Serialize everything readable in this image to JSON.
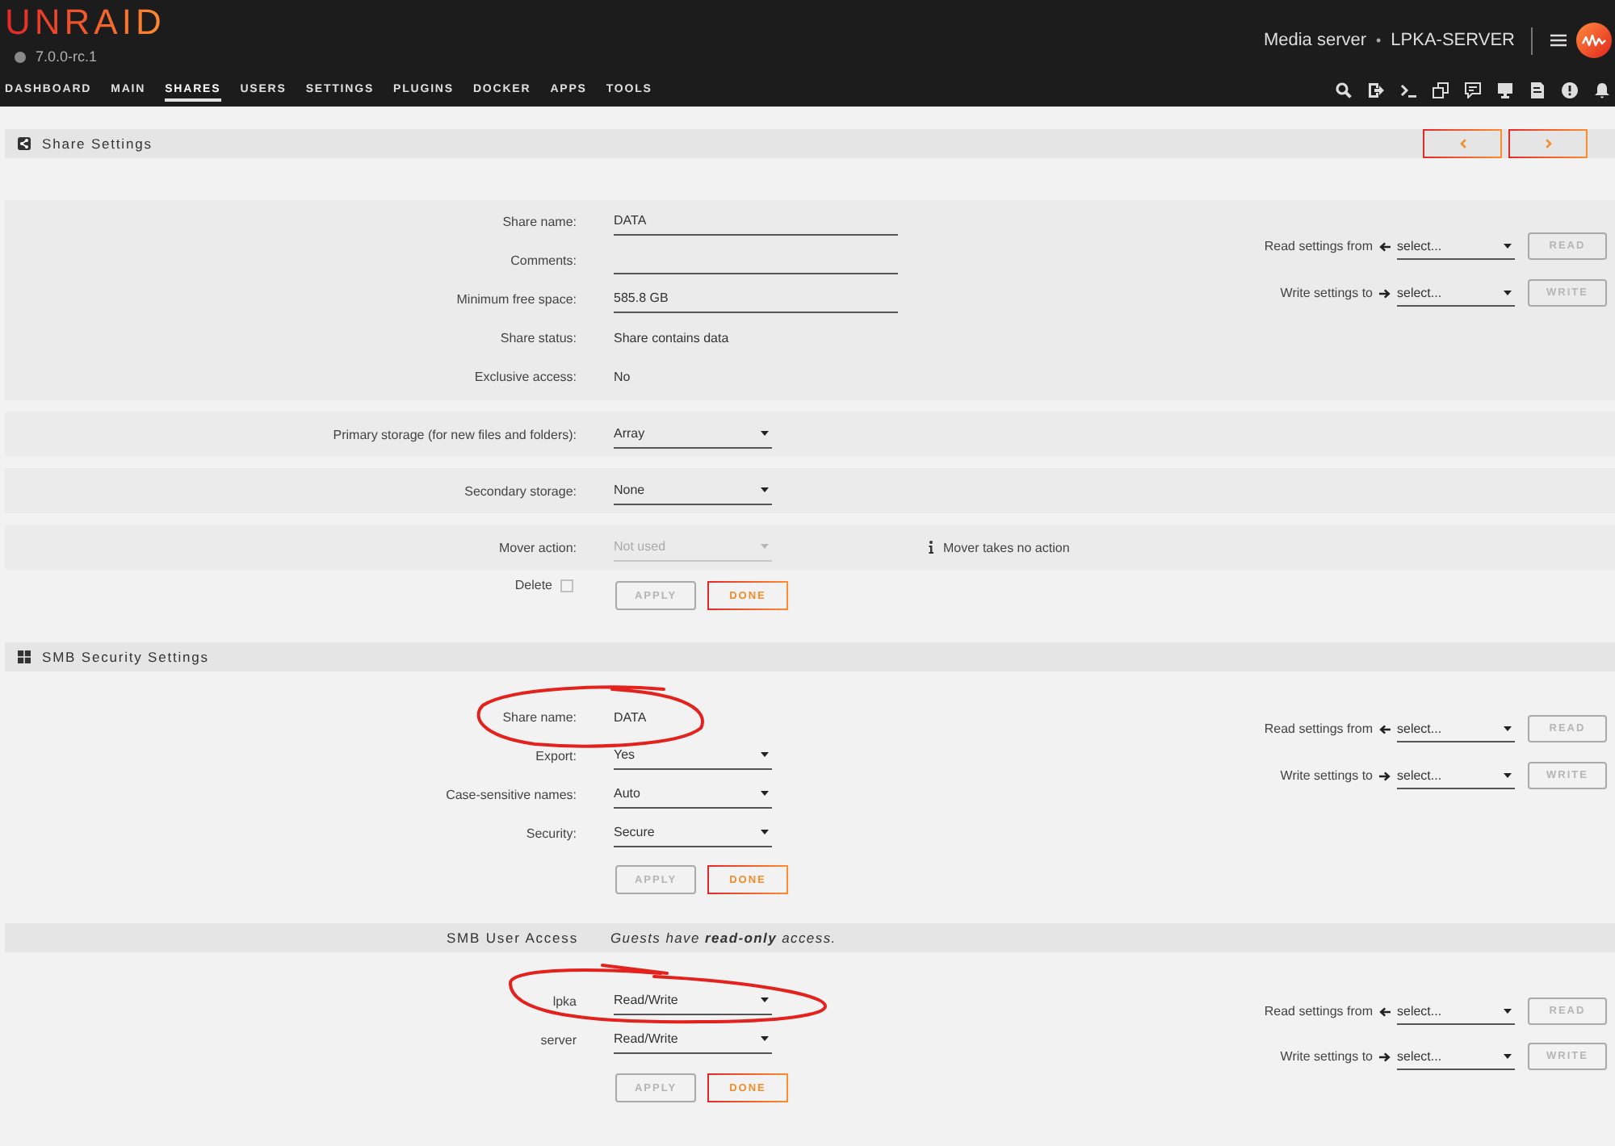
{
  "header": {
    "logo": "UNRAID",
    "version": "7.0.0-rc.1",
    "server_description": "Media server",
    "separator": "•",
    "server_name": "LPKA-SERVER"
  },
  "nav": [
    {
      "label": "DASHBOARD",
      "selected": false
    },
    {
      "label": "MAIN",
      "selected": false
    },
    {
      "label": "SHARES",
      "selected": true
    },
    {
      "label": "USERS",
      "selected": false
    },
    {
      "label": "SETTINGS",
      "selected": false
    },
    {
      "label": "PLUGINS",
      "selected": false
    },
    {
      "label": "DOCKER",
      "selected": false
    },
    {
      "label": "APPS",
      "selected": false
    },
    {
      "label": "TOOLS",
      "selected": false
    }
  ],
  "share_settings": {
    "title": "Share Settings",
    "groups": [
      {
        "fields": [
          {
            "label": "Share name:",
            "kind": "input",
            "value": "DATA",
            "disabled": false
          },
          {
            "label": "Comments:",
            "kind": "input",
            "disabled": false
          },
          {
            "label": "Minimum free space:",
            "kind": "input",
            "value": "585.8 GB",
            "disabled": false
          },
          {
            "label": "Share status:",
            "kind": "text",
            "value": "Share contains data",
            "disabled": false
          },
          {
            "label": "Exclusive access:",
            "kind": "text",
            "value": "No",
            "disabled": false
          }
        ],
        "sync": [
          {
            "kind": "read",
            "label": "Read settings from",
            "value": "select...",
            "button": "READ",
            "disabled": true
          },
          {
            "kind": "write",
            "label": "Write settings to",
            "value": "select...",
            "button": "WRITE",
            "disabled": true
          }
        ]
      },
      {
        "fields": [
          {
            "label": "Primary storage (for new files and folders):",
            "kind": "select",
            "value": "Array",
            "disabled": false
          }
        ]
      },
      {
        "fields": [
          {
            "label": "Secondary storage:",
            "kind": "select",
            "value": "None",
            "disabled": false
          }
        ]
      },
      {
        "fields": [
          {
            "label": "Mover action:",
            "kind": "select",
            "value": "Not used",
            "disabled": true,
            "note": "Mover takes no action"
          }
        ]
      }
    ],
    "delete": {
      "label": "Delete",
      "checked": false
    },
    "buttons": [
      {
        "label": "APPLY",
        "disabled": true
      },
      {
        "label": "DONE",
        "disabled": false
      }
    ]
  },
  "smb_security": {
    "title": "SMB Security Settings",
    "fields": [
      {
        "label": "Share name:",
        "kind": "text",
        "value": "DATA",
        "disabled": false,
        "circled": true
      },
      {
        "label": "Export:",
        "kind": "select",
        "value": "Yes",
        "disabled": false,
        "circled": false
      },
      {
        "label": "Case-sensitive names:",
        "kind": "select",
        "value": "Auto",
        "disabled": false,
        "circled": false
      },
      {
        "label": "Security:",
        "kind": "select",
        "value": "Secure",
        "disabled": false,
        "circled": false
      }
    ],
    "buttons": [
      {
        "label": "APPLY",
        "disabled": true
      },
      {
        "label": "DONE",
        "disabled": false
      }
    ],
    "sync": [
      {
        "kind": "read",
        "label": "Read settings from",
        "value": "select...",
        "button": "READ",
        "disabled": true
      },
      {
        "kind": "write",
        "label": "Write settings to",
        "value": "select...",
        "button": "WRITE",
        "disabled": true
      }
    ]
  },
  "smb_user_access": {
    "title": "SMB User Access",
    "note": "Guests have **read-only** access.",
    "users": [
      {
        "label": "lpka",
        "kind": "select",
        "value": "Read/Write",
        "disabled": false,
        "circled": true
      },
      {
        "label": "server",
        "kind": "select",
        "value": "Read/Write",
        "disabled": false,
        "circled": false
      }
    ],
    "buttons": [
      {
        "label": "APPLY",
        "disabled": true
      },
      {
        "label": "DONE",
        "disabled": false
      }
    ],
    "sync": [
      {
        "kind": "read",
        "label": "Read settings from",
        "value": "select...",
        "button": "READ",
        "disabled": true
      },
      {
        "kind": "write",
        "label": "Write settings to",
        "value": "select...",
        "button": "WRITE",
        "disabled": true
      }
    ]
  }
}
